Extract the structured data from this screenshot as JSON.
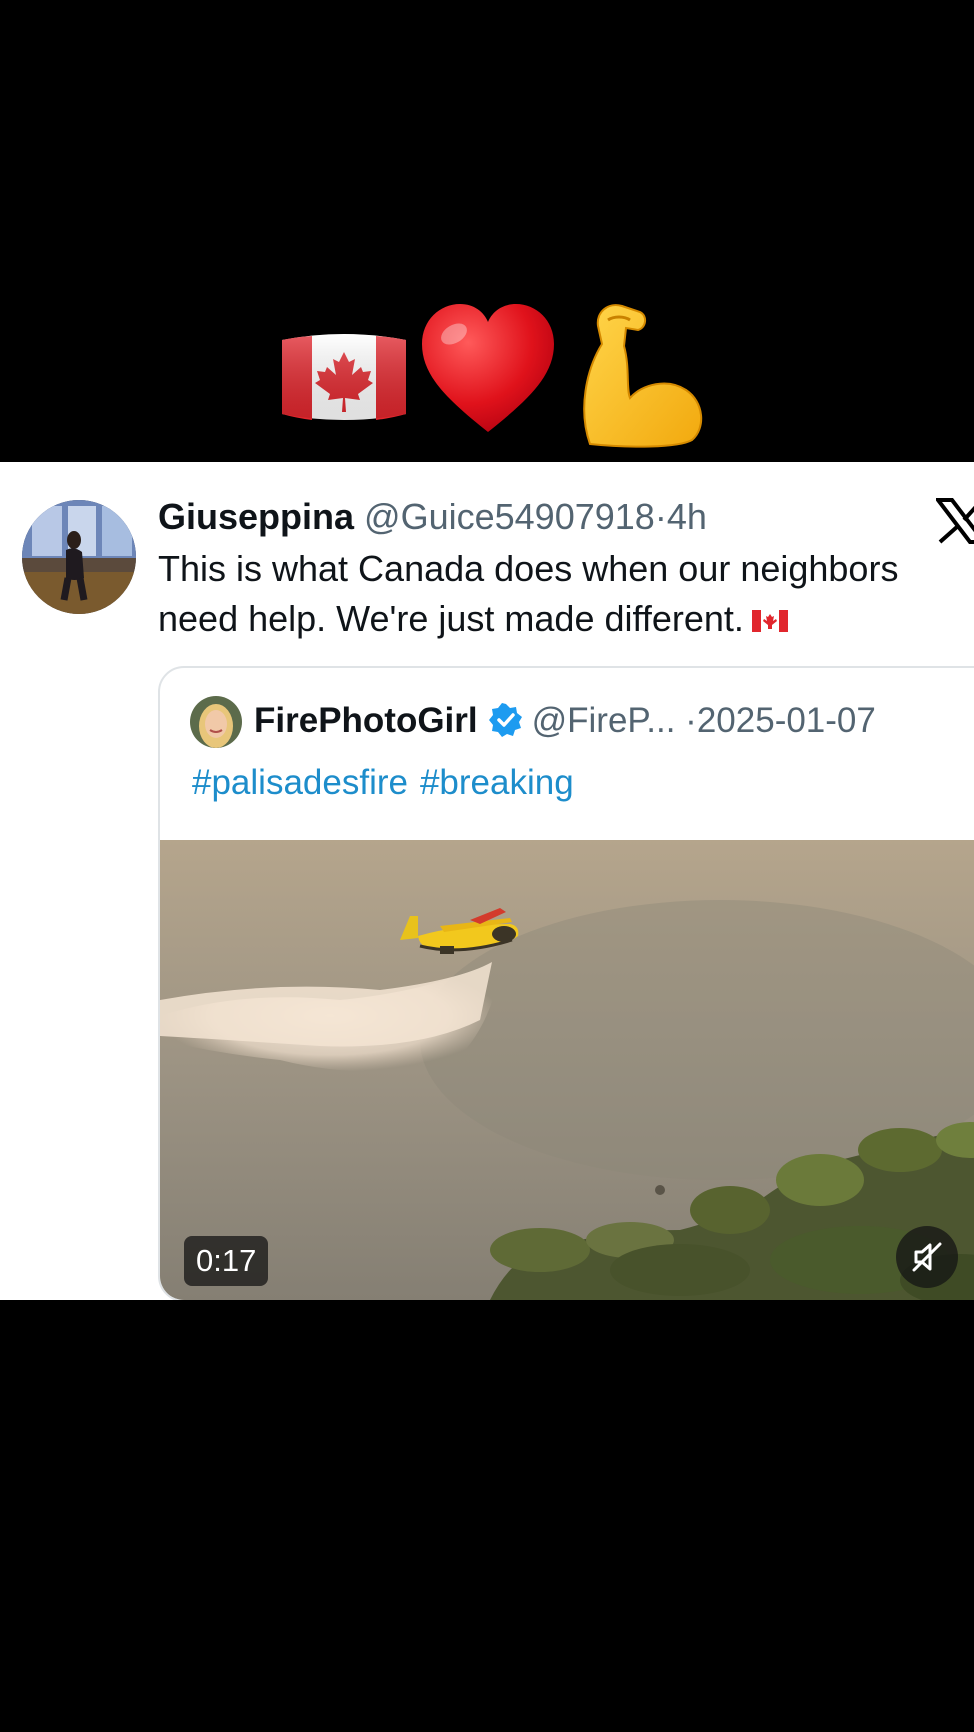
{
  "banner": {
    "emojis": [
      "canada-flag-icon",
      "red-heart-icon",
      "flexed-biceps-icon"
    ]
  },
  "tweet": {
    "display_name": "Giuseppina",
    "handle": "@Guice54907918",
    "separator": "·",
    "time": "4h",
    "text": "This is what Canada does when our neighbors need help. We're just made different.",
    "trailing_emoji": "canada-flag-icon"
  },
  "quote": {
    "display_name": "FirePhotoGirl",
    "handle": "@FireP...",
    "separator": "·",
    "date": "2025-01-07",
    "hashtags": [
      "#palisadesfire",
      "#breaking"
    ],
    "video": {
      "duration": "0:17",
      "muted": true
    }
  },
  "colors": {
    "link": "#1d8dcb",
    "verified": "#1d9bf0",
    "secondary_text": "#536471"
  }
}
